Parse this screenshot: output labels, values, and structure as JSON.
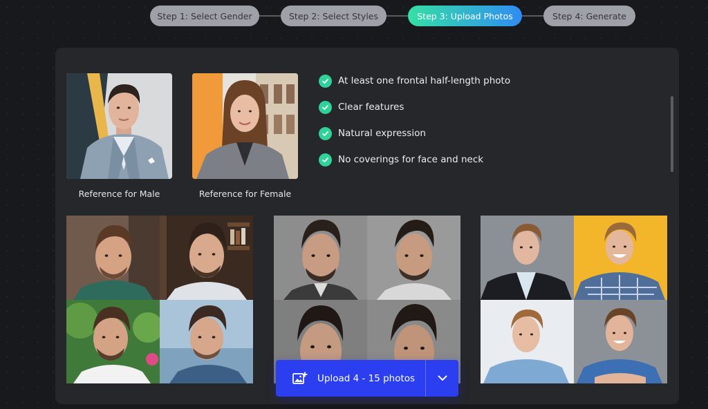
{
  "steps": [
    {
      "label": "Step 1: Select Gender",
      "state": "done"
    },
    {
      "label": "Step 2: Select Styles",
      "state": "done"
    },
    {
      "label": "Step 3: Upload Photos",
      "state": "active"
    },
    {
      "label": "Step 4: Generate",
      "state": "pending"
    }
  ],
  "references": {
    "male_caption": "Reference for Male",
    "female_caption": "Reference for Female"
  },
  "requirements": [
    "At least one frontal half-length photo",
    "Clear features",
    "Natural expression",
    "No coverings for face and neck"
  ],
  "upload": {
    "label": "Upload 4 - 15 photos",
    "icon": "add-image-icon",
    "toggle_icon": "chevron-down-icon"
  },
  "colors": {
    "accent_green": "#2fd39a",
    "upload_blue": "#2b3ff0",
    "active_gradient_start": "#35e0a4",
    "active_gradient_end": "#2f8cf3"
  }
}
